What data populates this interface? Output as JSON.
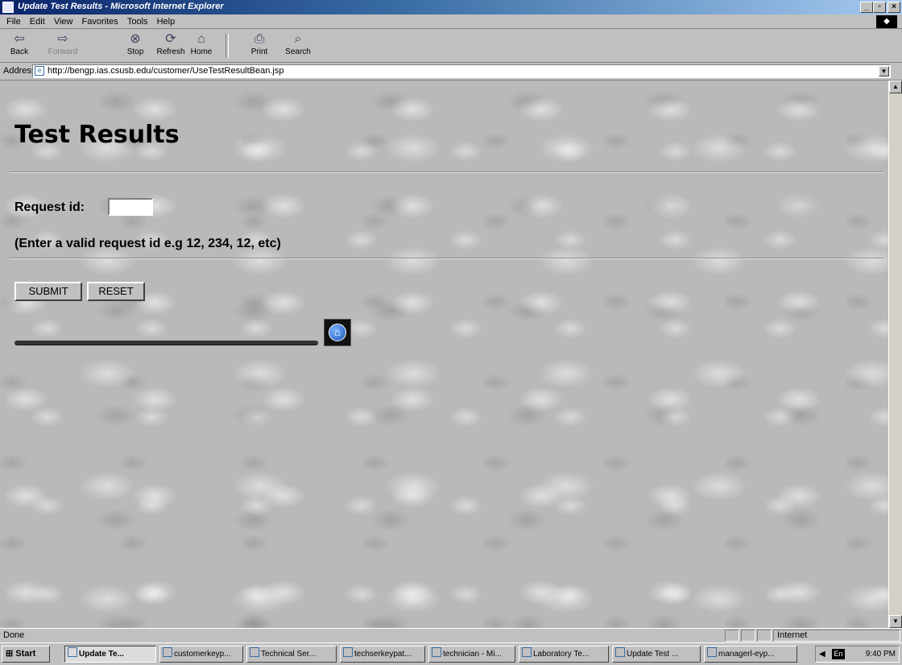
{
  "window": {
    "title": "Update Test Results - Microsoft Internet Explorer"
  },
  "menu": [
    "File",
    "Edit",
    "View",
    "Favorites",
    "Tools",
    "Help"
  ],
  "toolbar": [
    {
      "label": "Back",
      "icon": "back-arrow-icon",
      "enabled": true
    },
    {
      "label": "Forward",
      "icon": "forward-arrow-icon",
      "enabled": false
    },
    {
      "label": "Stop",
      "icon": "stop-icon",
      "enabled": true
    },
    {
      "label": "Refresh",
      "icon": "refresh-icon",
      "enabled": true
    },
    {
      "label": "Home",
      "icon": "home-icon",
      "enabled": true
    },
    {
      "label": "Print",
      "icon": "printer-icon",
      "enabled": true
    },
    {
      "label": "Search",
      "icon": "search-icon",
      "enabled": true
    }
  ],
  "address": {
    "label": "Address",
    "url": "http://bengp.ias.csusb.edu/customer/UseTestResultBean.jsp"
  },
  "page": {
    "heading": "Test Results",
    "request_label": "Request id:",
    "request_value": "",
    "hint": "(Enter a valid request id e.g 12, 234, 12, etc)",
    "submit_label": "SUBMIT",
    "reset_label": "RESET"
  },
  "status": {
    "text": "Done",
    "zone": "Internet"
  },
  "taskbar": {
    "start_label": "Start",
    "tasks": [
      {
        "label": "Update Te...",
        "active": true
      },
      {
        "label": "customerkeyp...",
        "active": false
      },
      {
        "label": "Technical Ser...",
        "active": false
      },
      {
        "label": "techserkeypat...",
        "active": false
      },
      {
        "label": "technician - Mi...",
        "active": false
      },
      {
        "label": "Laboratory Te...",
        "active": false
      },
      {
        "label": "Update Test ...",
        "active": false
      },
      {
        "label": "managerl-eyp...",
        "active": false
      }
    ],
    "lang": "En",
    "clock": "9:40 PM"
  }
}
